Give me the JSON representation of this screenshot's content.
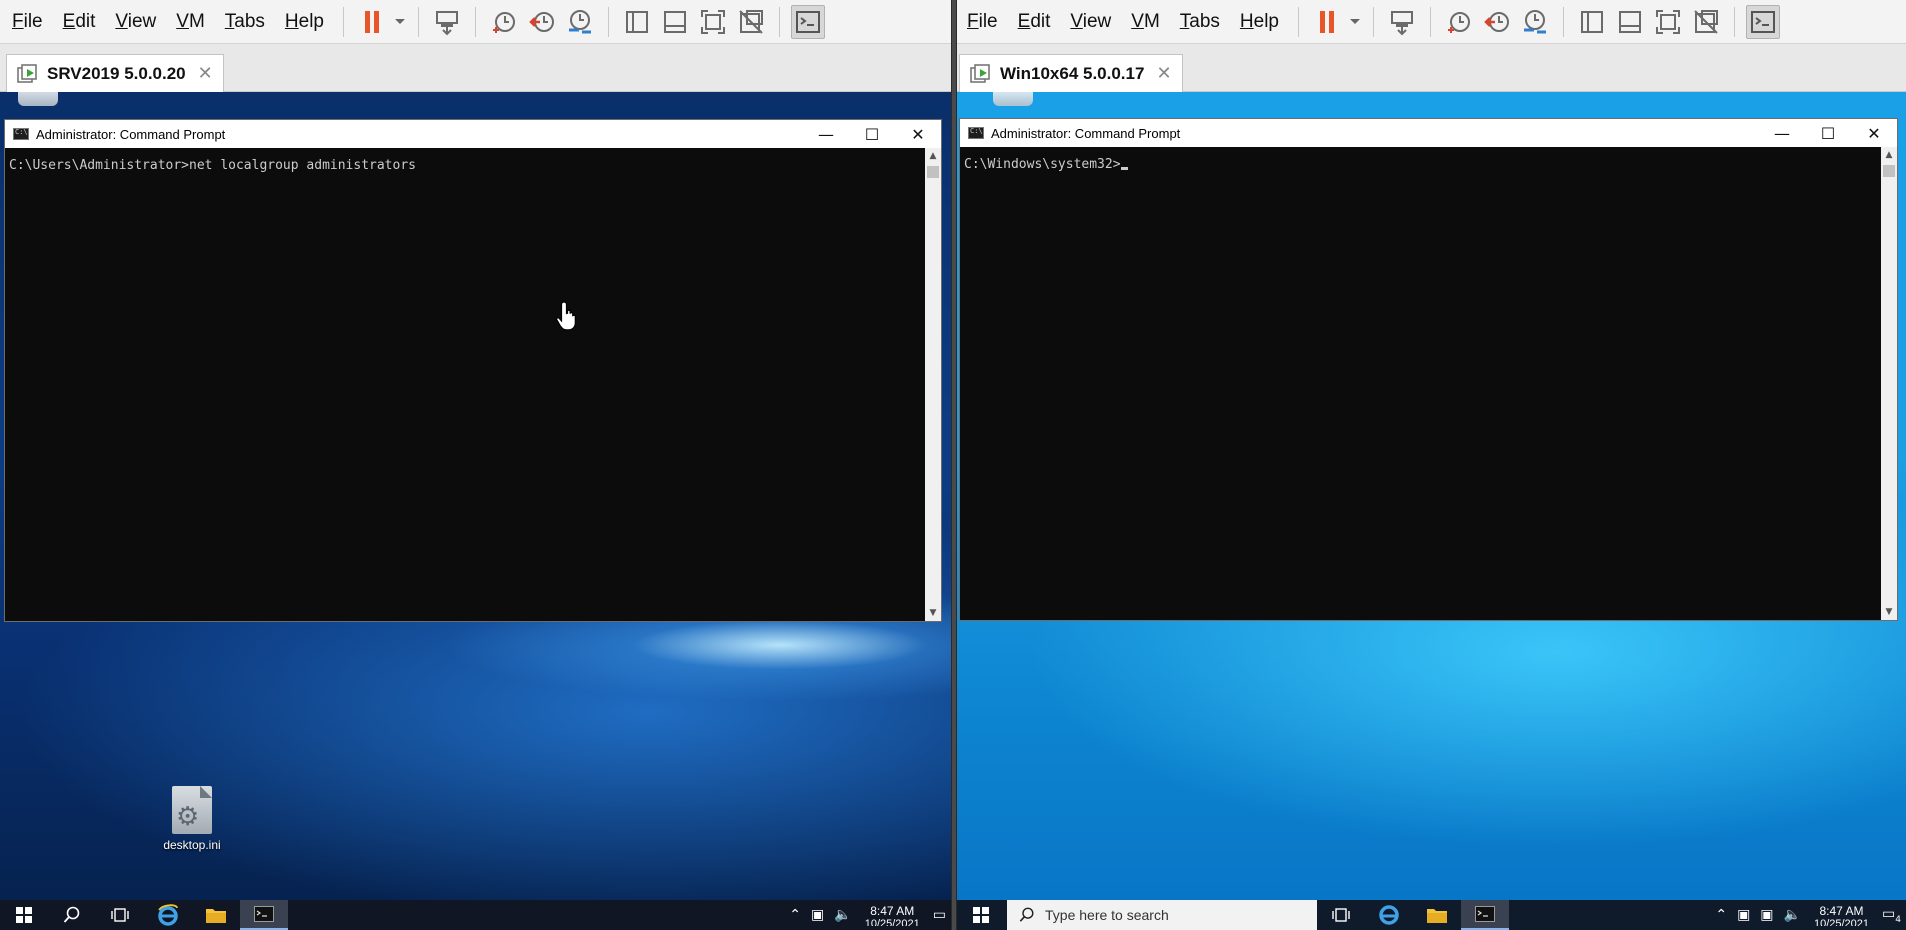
{
  "colors": {
    "pause": "#e8552a",
    "toolbar_icon": "#6b6b6b",
    "snapshot_blue": "#2f7fd1",
    "snapshot_red": "#d9432c",
    "vm_icon_green": "#3aa33a"
  },
  "left": {
    "menu": [
      {
        "u": "F",
        "rest": "ile"
      },
      {
        "u": "E",
        "rest": "dit"
      },
      {
        "u": "V",
        "rest": "iew"
      },
      {
        "u": "V",
        "rest": "M"
      },
      {
        "u": "T",
        "rest": "abs"
      },
      {
        "u": "H",
        "rest": "elp"
      }
    ],
    "tab": {
      "name": "SRV2019 5.0.0.20",
      "close": "✕"
    },
    "cmd": {
      "title": "Administrator: Command Prompt",
      "prompt": "C:\\Users\\Administrator>",
      "command": "net localgroup administrators"
    },
    "desktop_icon": {
      "label": "desktop.ini"
    },
    "taskbar": {
      "time": "8:47 AM",
      "date": "10/25/2021"
    }
  },
  "right": {
    "menu": [
      {
        "u": "F",
        "rest": "ile"
      },
      {
        "u": "E",
        "rest": "dit"
      },
      {
        "u": "V",
        "rest": "iew"
      },
      {
        "u": "V",
        "rest": "M"
      },
      {
        "u": "T",
        "rest": "abs"
      },
      {
        "u": "H",
        "rest": "elp"
      }
    ],
    "tab": {
      "name": "Win10x64 5.0.0.17",
      "close": "✕"
    },
    "cmd": {
      "title": "Administrator: Command Prompt",
      "prompt": "C:\\Windows\\system32>",
      "command": ""
    },
    "taskbar": {
      "search_placeholder": "Type here to search",
      "time": "8:47 AM",
      "date": "10/25/2021",
      "notification_count": "4"
    }
  },
  "window_controls": {
    "minimize": "—",
    "maximize": "☐",
    "close": "✕"
  },
  "icons": {
    "pause": "pause-icon",
    "send_ctrl_alt_del": "send-ctrl-alt-del-icon",
    "snapshot_take": "snapshot-take-icon",
    "snapshot_revert": "snapshot-revert-icon",
    "snapshot_manager": "snapshot-manager-icon",
    "library": "library-icon",
    "thumbnail_bar": "thumbnail-bar-icon",
    "fullscreen": "fullscreen-icon",
    "unity": "unity-icon",
    "console_view": "console-view-icon"
  }
}
